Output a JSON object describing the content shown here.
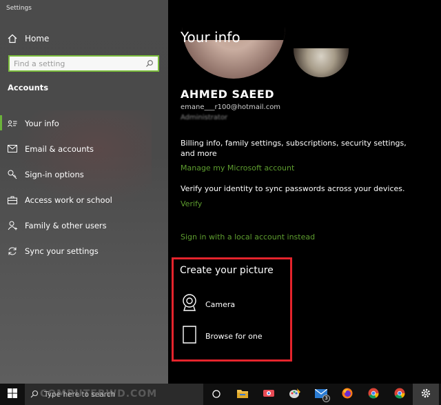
{
  "window": {
    "title": "Settings"
  },
  "sidebar": {
    "home_label": "Home",
    "search_placeholder": "Find a setting",
    "section_label": "Accounts",
    "items": [
      {
        "label": "Your info",
        "icon": "person-card-icon",
        "active": true
      },
      {
        "label": "Email & accounts",
        "icon": "mail-icon"
      },
      {
        "label": "Sign-in options",
        "icon": "key-icon"
      },
      {
        "label": "Access work or school",
        "icon": "briefcase-icon"
      },
      {
        "label": "Family & other users",
        "icon": "person-add-icon"
      },
      {
        "label": "Sync your settings",
        "icon": "sync-icon"
      }
    ]
  },
  "main": {
    "title": "Your info",
    "user_name": "AHMED SAEED",
    "user_email": "emane___r100@hotmail.com",
    "user_role": "Administrator",
    "billing_text": "Billing info, family settings, subscriptions, security settings, and more",
    "manage_link": "Manage my Microsoft account",
    "verify_text": "Verify your identity to sync passwords across your devices.",
    "verify_link": "Verify",
    "local_link": "Sign in with a local account instead",
    "create": {
      "title": "Create your picture",
      "camera_label": "Camera",
      "browse_label": "Browse for one"
    }
  },
  "taskbar": {
    "search_placeholder": "Type here to search",
    "mail_badge": "3",
    "watermark": "COMPUTERWD.COM"
  },
  "colors": {
    "accent_green": "#6bb33a",
    "link_green": "#5e9e2f",
    "highlight_red": "#e5242c"
  }
}
